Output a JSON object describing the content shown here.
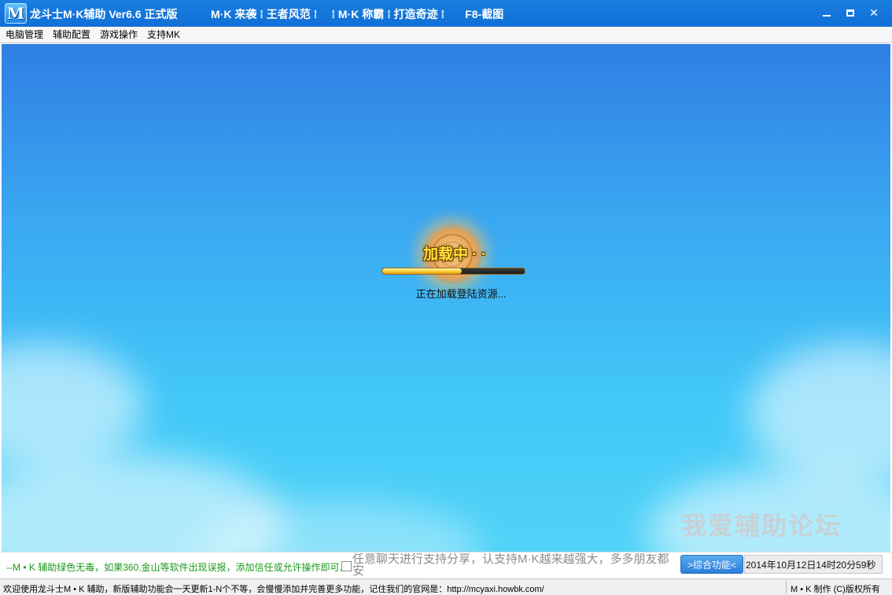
{
  "titlebar": {
    "logo_letter": "M",
    "app_title": "龙斗士M·K辅助 Ver6.6 正式版",
    "tabs": [
      "M·K 来袭 ⁞ 王者风范 ⁞",
      "⁞ M·K 称霸 ⁞ 打造奇迹 ⁞",
      "F8-截图"
    ],
    "close_glyph": "✕"
  },
  "menubar": {
    "items": [
      "电脑管理",
      "辅助配置",
      "游戏操作",
      "支持MK"
    ]
  },
  "game": {
    "loading_text": "加载中 · ·",
    "progress": 0.56,
    "loading_status": "正在加载登陆资源...",
    "watermark": "我爱辅助论坛"
  },
  "infobar": {
    "tip": "--M • K 辅助绿色无毒，如果360.金山等软件出现误报，添加信任或允许操作即可.",
    "scroll_line1": "任意聊天进行支持分享，认支持M·K越来越强大，多多朋友都",
    "scroll_line2": "安",
    "feature_button": ">综合功能<",
    "datetime": "2014年10月12日14时20分59秒"
  },
  "statusbar": {
    "left": "欢迎使用龙斗士M • K 辅助，新版辅助功能会一天更新1-N个不等，会慢慢添加并完善更多功能，记住我们的官网是：http://mcyaxi.howbk.com/",
    "right": "M • K 制作 (C)版权所有"
  },
  "colors": {
    "titlebar": "#0f6fd6",
    "tip_text": "#1a9a1a",
    "loading_text": "#ffe23a"
  }
}
